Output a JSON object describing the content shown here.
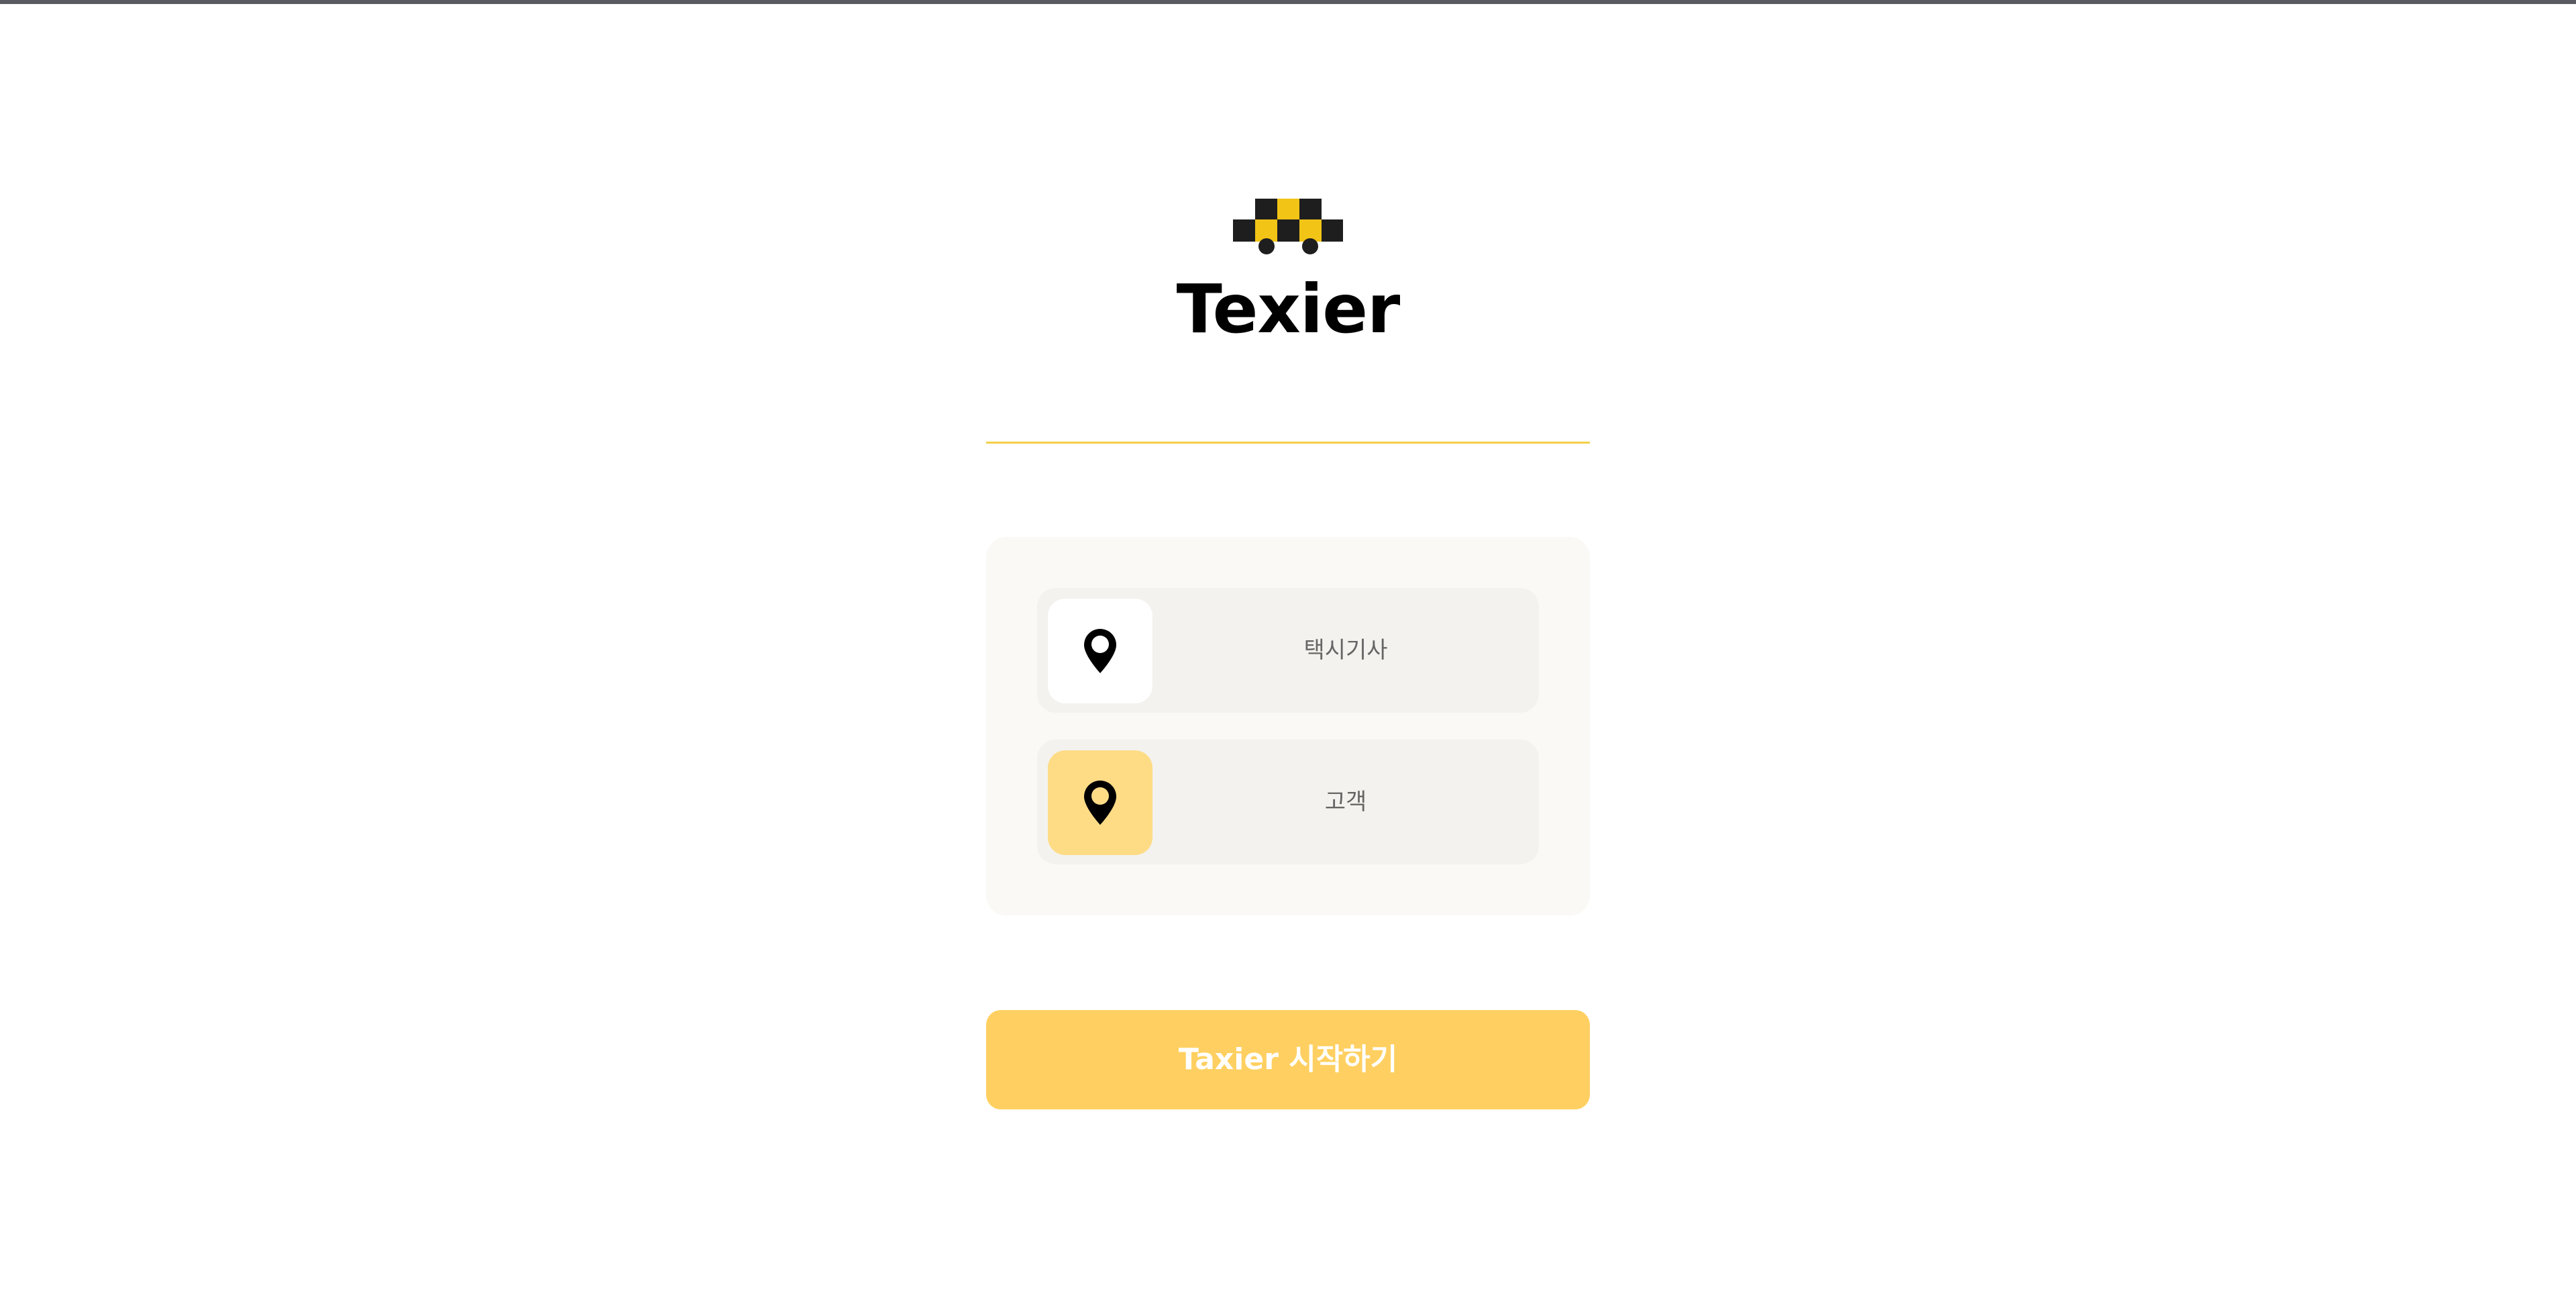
{
  "app": {
    "brand_name": "Texier",
    "logo_icon": "checkered-taxi-icon"
  },
  "roles": [
    {
      "label": "택시기사",
      "icon": "map-pin-icon",
      "selected": false
    },
    {
      "label": "고객",
      "icon": "map-pin-icon",
      "selected": true
    }
  ],
  "actions": {
    "start_label": "Taxier 시작하기"
  },
  "colors": {
    "accent": "#ffd061",
    "accent_light": "#fedc86",
    "divider": "#f5cf48",
    "logo_yellow": "#f2c416",
    "logo_dark": "#1e1e1e",
    "panel_bg": "#faf9f6",
    "option_bg": "#f3f2ee"
  }
}
